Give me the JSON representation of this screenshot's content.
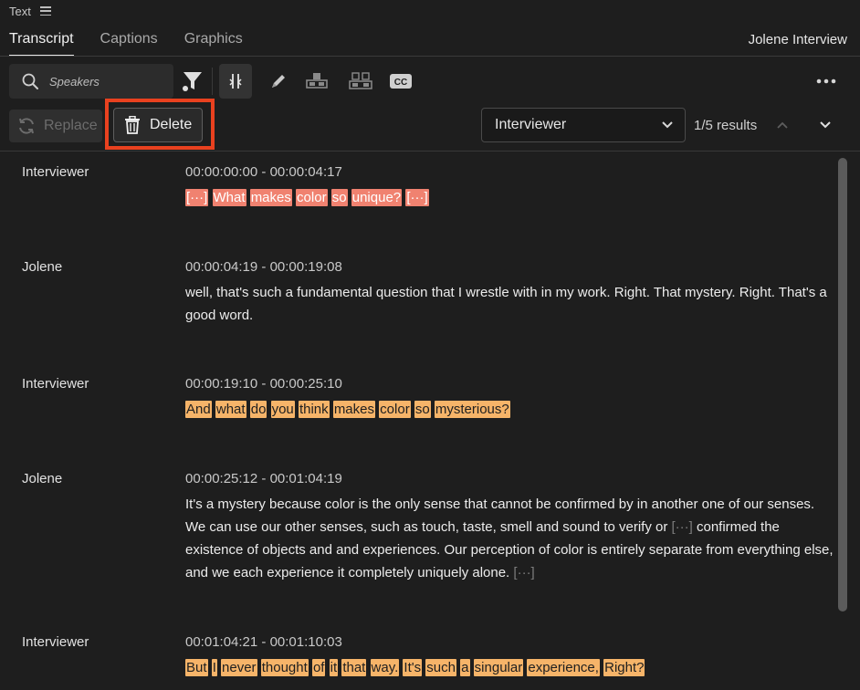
{
  "panel": {
    "title": "Text"
  },
  "tabs": [
    {
      "label": "Transcript",
      "active": true
    },
    {
      "label": "Captions",
      "active": false
    },
    {
      "label": "Graphics",
      "active": false
    }
  ],
  "project_title": "Jolene Interview",
  "search": {
    "placeholder": "Speakers"
  },
  "toolbar": {
    "icons": [
      "search-icon",
      "filter-icon",
      "split-icon",
      "pencil-icon",
      "speaker-one-icon",
      "speaker-two-icon",
      "cc-icon",
      "more-icon"
    ],
    "replace_label": "Replace",
    "delete_label": "Delete",
    "speaker_select": "Interviewer",
    "results": "1/5 results"
  },
  "colors": {
    "background": "#1e1e1e",
    "highlight_red": "#f08270",
    "highlight_orange": "#f6b469",
    "focus_outline": "#e9411f"
  },
  "transcript": [
    {
      "speaker": "Interviewer",
      "timecode": "00:00:00:00 - 00:00:04:17",
      "highlight": "red",
      "words": [
        "[···]",
        "What",
        "makes",
        "color",
        "so",
        "unique?",
        "[···]"
      ]
    },
    {
      "speaker": "Jolene",
      "timecode": "00:00:04:19 - 00:00:19:08",
      "text": "well, that's such a fundamental question that I wrestle with in my work. Right. That mystery. Right. That's a good word."
    },
    {
      "speaker": "Interviewer",
      "timecode": "00:00:19:10 - 00:00:25:10",
      "highlight": "orange",
      "words": [
        "And",
        "what",
        "do",
        "you",
        "think",
        "makes",
        "color",
        "so",
        "mysterious?"
      ]
    },
    {
      "speaker": "Jolene",
      "timecode": "00:00:25:12 - 00:01:04:19",
      "text_a": "It's a mystery because color is the only sense that cannot be confirmed by in another one of our senses. We can use our other senses, such as touch, taste, smell and sound to verify or ",
      "gap_a": "[···]",
      "text_b": " confirmed the existence of objects and and experiences. Our perception of color is entirely separate from everything else, and we each experience it completely uniquely alone. ",
      "gap_b": "[···]"
    },
    {
      "speaker": "Interviewer",
      "timecode": "00:01:04:21 - 00:01:10:03",
      "highlight": "orange",
      "words": [
        "But",
        "I",
        "never",
        "thought",
        "of",
        "it",
        "that",
        "way.",
        "It's",
        "such",
        "a",
        "singular",
        "experience,",
        "Right?"
      ]
    }
  ]
}
